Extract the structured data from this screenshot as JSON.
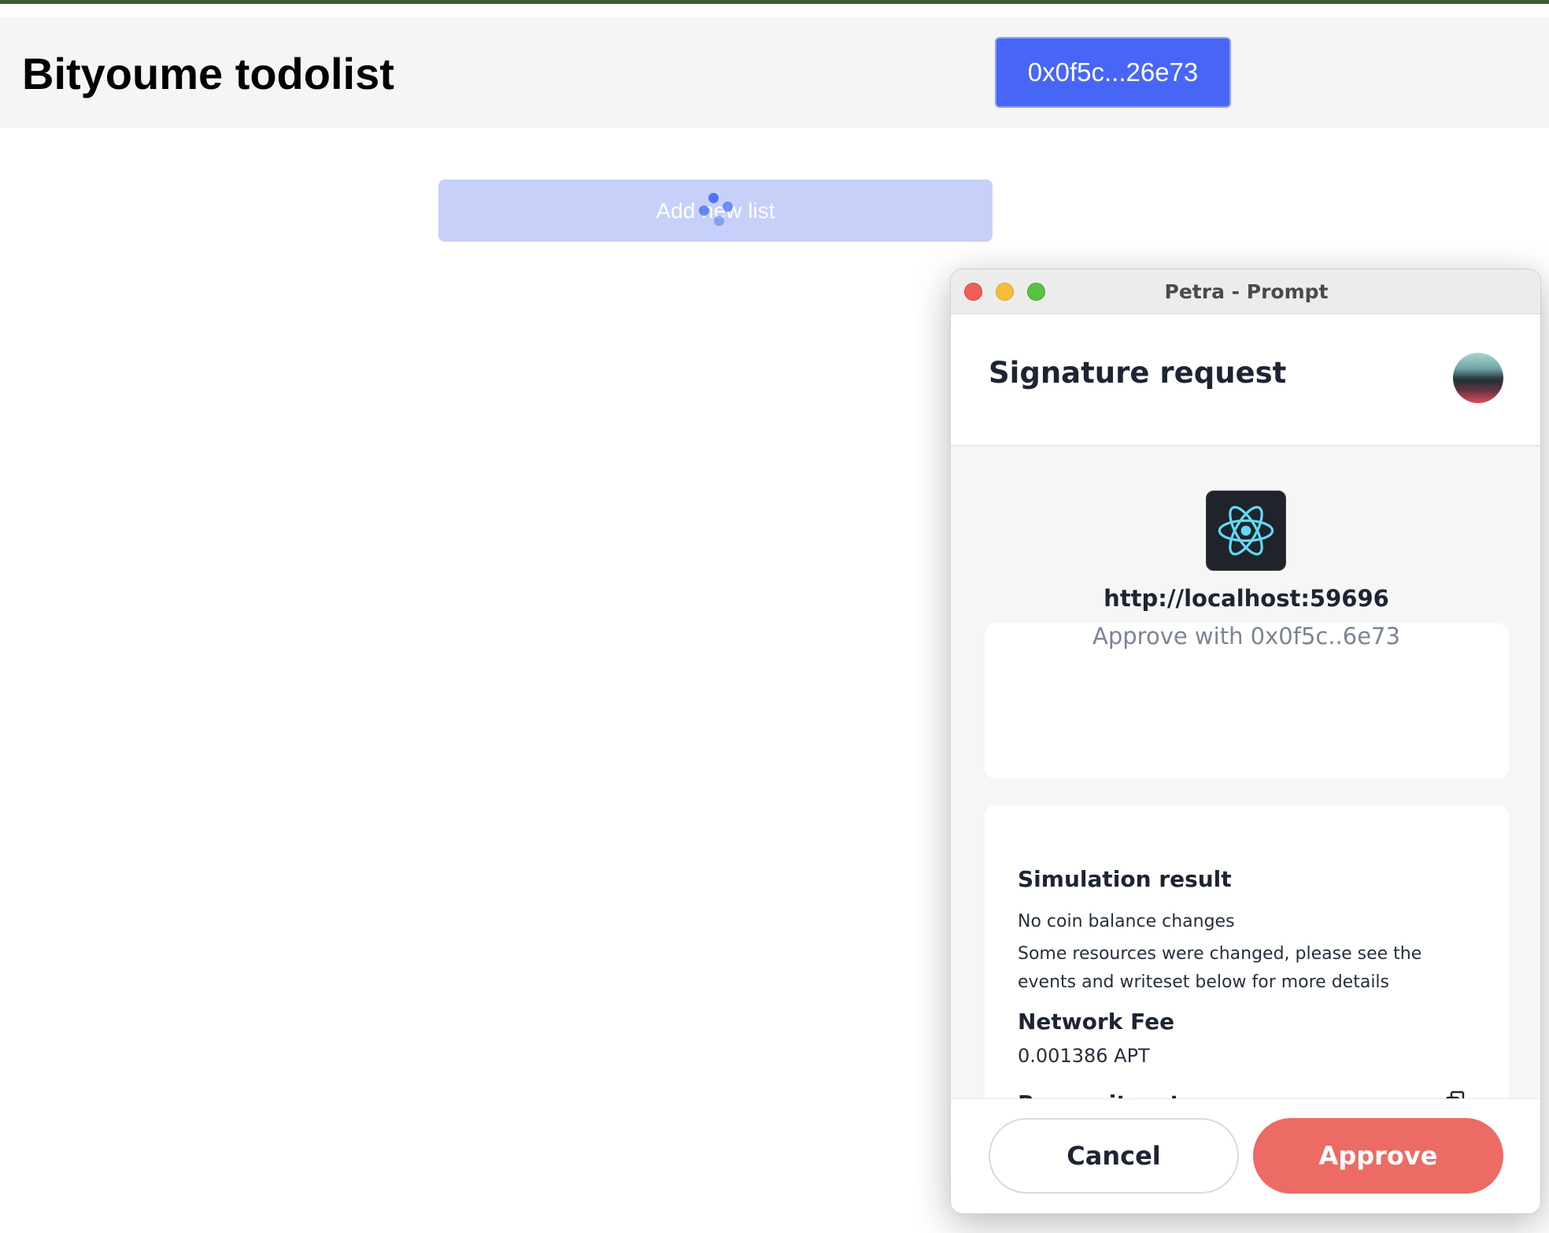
{
  "app": {
    "title": "Bityoume todolist",
    "wallet_address": "0x0f5c...26e73",
    "add_list_label": "Add new list"
  },
  "petra": {
    "window_title": "Petra - Prompt",
    "heading": "Signature request",
    "dapp": {
      "url": "http://localhost:59696",
      "approve_with": "Approve with 0x0f5c..6e73",
      "icon": "react-logo-icon"
    },
    "simulation": {
      "title": "Simulation result",
      "coin_changes": "No coin balance changes",
      "resources_note": "Some resources were changed, please see the events and writeset below for more details"
    },
    "network_fee": {
      "title": "Network Fee",
      "value": "0.001386 APT"
    },
    "raw_writeset": {
      "title": "Raw writeset",
      "expanded_icon": "chevron-up-icon",
      "copy_icon": "copy-icon"
    },
    "buttons": {
      "cancel": "Cancel",
      "approve": "Approve"
    }
  },
  "colors": {
    "wallet_button": "#4766f8",
    "add_list_button": "#c7d0f9",
    "approve_button": "#ec6b64",
    "top_accent": "#3e5f35"
  }
}
